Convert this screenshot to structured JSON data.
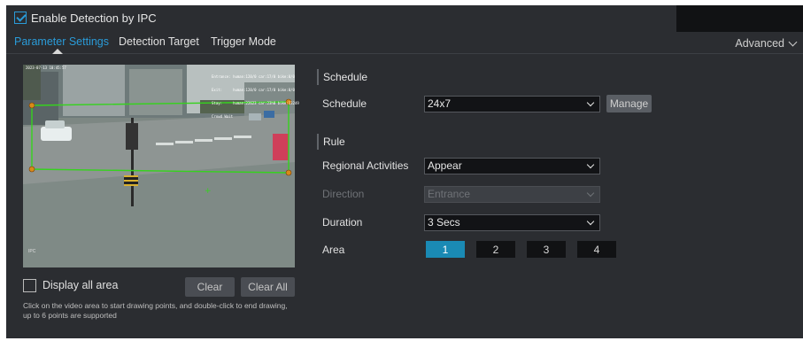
{
  "enable": {
    "label": "Enable Detection by IPC",
    "checked": true
  },
  "tabs": [
    {
      "label": "Parameter Settings",
      "active": true
    },
    {
      "label": "Detection Target",
      "active": false
    },
    {
      "label": "Trigger Mode",
      "active": false
    }
  ],
  "advanced": {
    "label": "Advanced"
  },
  "video": {
    "overlay_left": "2023-07-13 10:45:57",
    "overlay_right": [
      "Entrance: human:120/0 car:17/0 bike:0/0",
      "Exit:     human:120/0 car:17/0 bike:0/0",
      "Stay:     human:22623 car:23h0 bike:13249",
      "Crowd Wait"
    ],
    "corner_label": "IPC"
  },
  "display_all": {
    "label": "Display all area",
    "checked": false
  },
  "buttons": {
    "clear": "Clear",
    "clear_all": "Clear All",
    "manage": "Manage"
  },
  "hint": "Click on the video area to start drawing points, and double-click to end drawing, up to 6 points are supported",
  "schedule_section": {
    "title": "Schedule",
    "label": "Schedule",
    "value": "24x7"
  },
  "rule_section": {
    "title": "Rule",
    "regional": {
      "label": "Regional Activities",
      "value": "Appear"
    },
    "direction": {
      "label": "Direction",
      "value": "Entrance",
      "disabled": true
    },
    "duration": {
      "label": "Duration",
      "value": "3 Secs"
    },
    "area": {
      "label": "Area",
      "options": [
        "1",
        "2",
        "3",
        "4"
      ],
      "selected": "1"
    }
  },
  "colors": {
    "accent": "#2a9bd8",
    "active_area": "#1a8ab4",
    "region_line": "#36d21e"
  }
}
